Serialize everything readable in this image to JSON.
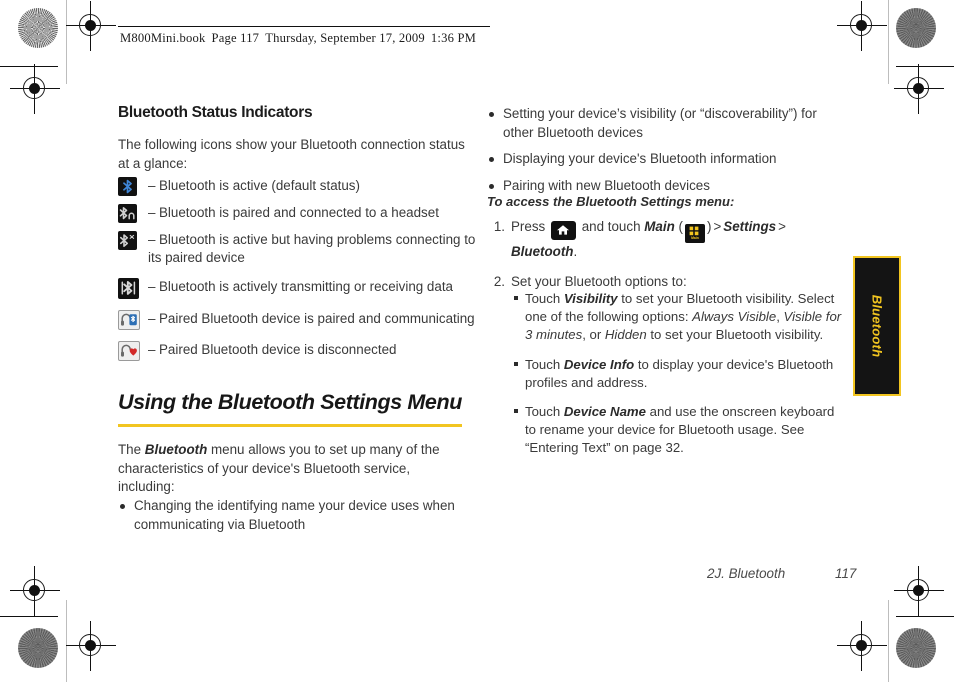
{
  "header": {
    "file": "M800Mini.book",
    "page_label": "Page 117",
    "date": "Thursday, September 17, 2009",
    "time": "1:36 PM"
  },
  "left_column": {
    "subheading": "Bluetooth Status Indicators",
    "intro": "The following icons show your Bluetooth connection status at a glance:",
    "status_icons": [
      {
        "icon": "bluetooth-active-icon",
        "dash": "–",
        "desc": "Bluetooth is active (default status)"
      },
      {
        "icon": "bluetooth-headset-connected-icon",
        "dash": "–",
        "desc": "Bluetooth is paired and connected to a headset"
      },
      {
        "icon": "bluetooth-problem-icon",
        "dash": "–",
        "desc": "Bluetooth is active but having problems connecting to its paired device"
      },
      {
        "icon": "bluetooth-transmitting-icon",
        "dash": "–",
        "desc": "Bluetooth is actively transmitting or receiving data"
      },
      {
        "icon": "headset-paired-communicating-icon",
        "dash": "–",
        "desc": "Paired Bluetooth device is paired and communicating"
      },
      {
        "icon": "headset-disconnected-icon",
        "dash": "–",
        "desc": "Paired Bluetooth device is disconnected"
      }
    ],
    "main_heading": "Using the Bluetooth Settings Menu",
    "body_before_em": "The ",
    "body_em": "Bluetooth",
    "body_after_em": " menu allows you to set up many of the characteristics of your device's Bluetooth service, including:",
    "bullets": [
      "Changing the identifying name your device uses when communicating via Bluetooth"
    ]
  },
  "right_column": {
    "bullets": [
      "Setting your device’s visibility (or “discoverability”) for other Bluetooth devices",
      "Displaying your device's Bluetooth information",
      "Pairing with new Bluetooth devices"
    ],
    "procedure_lead": "To access the Bluetooth Settings menu:",
    "step1": {
      "num": "1.",
      "text_press": "Press",
      "home_icon": "home-icon",
      "text_and_touch": "and touch",
      "em_main": "Main",
      "paren_open": "(",
      "main_icon": "main-grid-icon",
      "main_icon_label": "Main",
      "paren_close": ")",
      "gt1": ">",
      "em_settings": "Settings",
      "gt2": ">",
      "em_bluetooth": "Bluetooth",
      "period": "."
    },
    "step2": {
      "num": "2.",
      "text": "Set your Bluetooth options to:",
      "sub_bullets": [
        {
          "pre": "Touch ",
          "em1": "Visibility",
          "mid1": " to set your Bluetooth visibility. Select one of the following options: ",
          "em2": "Always Visible",
          "mid2": ", ",
          "em3": "Visible for 3 minutes",
          "mid3": ", or ",
          "em4": "Hidden",
          "post": " to set your Bluetooth visibility."
        },
        {
          "pre": "Touch ",
          "em1": "Device Info",
          "post": " to display your device's Bluetooth profiles and address."
        },
        {
          "pre": "Touch ",
          "em1": "Device Name",
          "post": " and use the onscreen keyboard to rename your device for Bluetooth usage. See “Entering Text” on page 32."
        }
      ]
    }
  },
  "side_tab": {
    "label": "Bluetooth"
  },
  "footer": {
    "chapter": "2J. Bluetooth",
    "page_number": "117"
  },
  "colors": {
    "accent_yellow": "#f2c520",
    "bluetooth_blue": "#2d6fb5",
    "heart_red": "#d32a2a",
    "tab_black": "#141414"
  }
}
